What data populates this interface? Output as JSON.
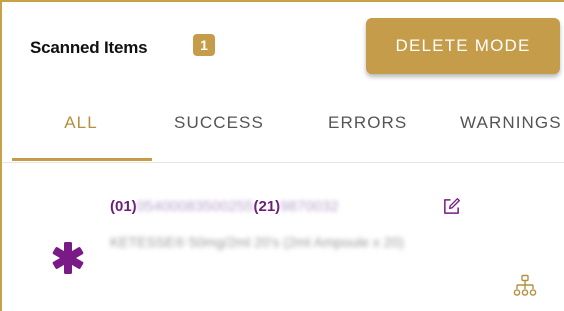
{
  "header": {
    "title": "Scanned Items",
    "count": "1",
    "delete_button_label": "DELETE MODE"
  },
  "tabs": [
    {
      "label": "ALL",
      "active": true
    },
    {
      "label": "SUCCESS",
      "active": false
    },
    {
      "label": "ERRORS",
      "active": false
    },
    {
      "label": "WARNINGS",
      "active": false
    }
  ],
  "items": [
    {
      "gtin_ai": "(01)",
      "gtin_value": "05400083500255",
      "serial_ai": "(21)",
      "serial_value": "9870032",
      "description": "KETESSE® 50mg/2ml 20's (2ml Ampoule x 20)",
      "status_icon": "asterisk-icon",
      "edit_icon": "edit-icon",
      "hierarchy_icon": "hierarchy-icon"
    }
  ],
  "colors": {
    "accent": "#c49c4a",
    "accent_text": "#b3913f",
    "code_purple": "#6a1f7a",
    "status_purple": "#7a1a86"
  }
}
